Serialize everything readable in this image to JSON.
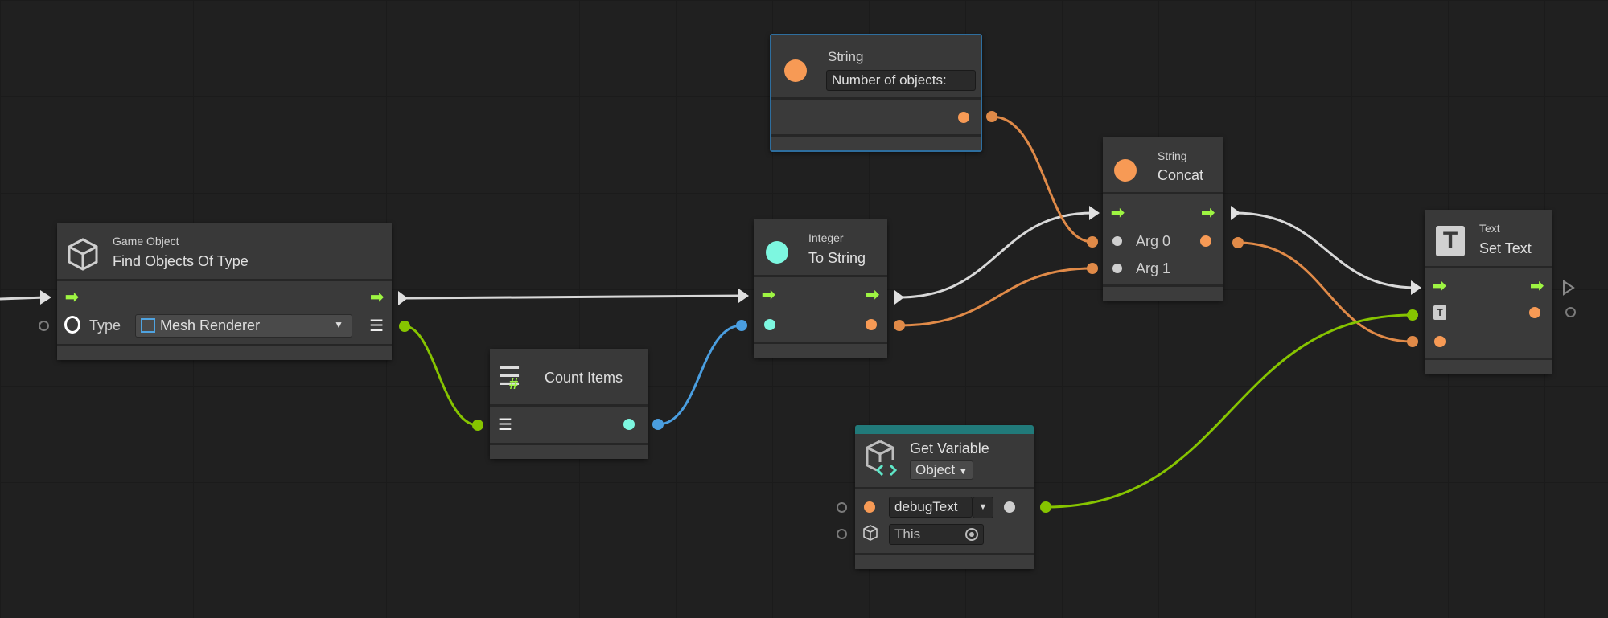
{
  "nodes": {
    "find_objects": {
      "category": "Game Object",
      "title": "Find Objects Of Type",
      "type_label": "Type",
      "type_value": "Mesh Renderer"
    },
    "count_items": {
      "title": "Count Items"
    },
    "to_string": {
      "category": "Integer",
      "title": "To String"
    },
    "string_literal": {
      "title": "String",
      "value": "Number of objects:"
    },
    "concat": {
      "category": "String",
      "title": "Concat",
      "arg0": "Arg 0",
      "arg1": "Arg 1"
    },
    "set_text": {
      "category": "Text",
      "title": "Set Text",
      "icon_letter": "T"
    },
    "get_variable": {
      "title": "Get Variable",
      "kind": "Object",
      "variable_name": "debugText",
      "target": "This"
    }
  },
  "colors": {
    "flow": "#9ef542",
    "string": "#f79a55",
    "integer": "#7df7e0",
    "list": "#86c400",
    "selected_border": "#2e6e9e",
    "variable_bar": "#217a7a"
  }
}
